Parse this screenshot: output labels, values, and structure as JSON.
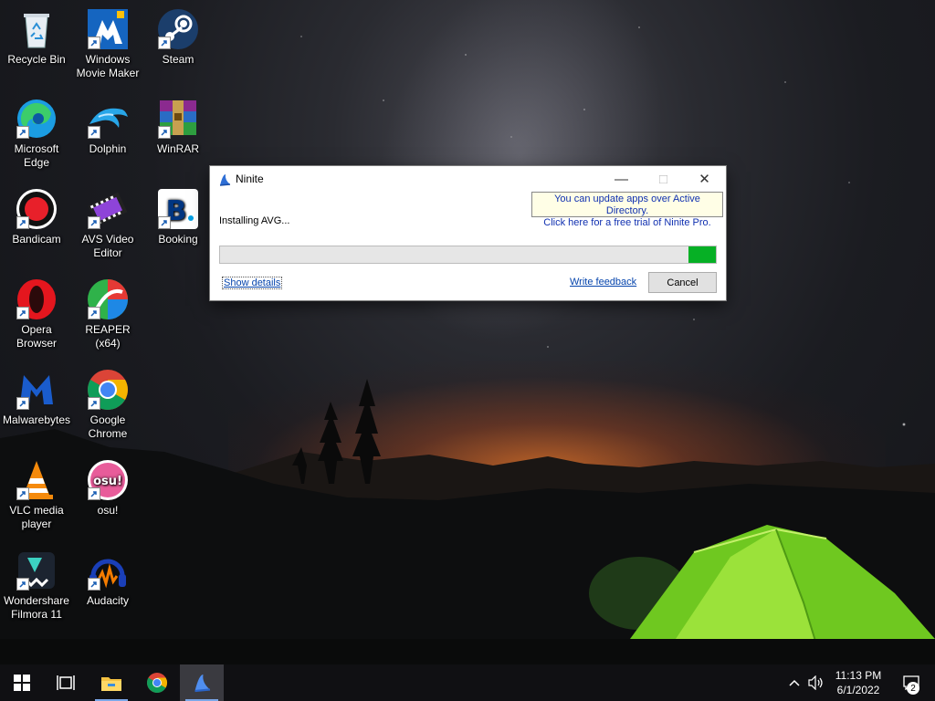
{
  "desktop": {
    "icons": [
      {
        "label": "Recycle Bin",
        "icon": "recycle-bin-icon"
      },
      {
        "label": "Windows Movie Maker",
        "icon": "movie-maker-icon"
      },
      {
        "label": "Steam",
        "icon": "steam-icon"
      },
      {
        "label": "Microsoft Edge",
        "icon": "edge-icon"
      },
      {
        "label": "Dolphin",
        "icon": "dolphin-icon"
      },
      {
        "label": "WinRAR",
        "icon": "winrar-icon"
      },
      {
        "label": "Bandicam",
        "icon": "bandicam-icon"
      },
      {
        "label": "AVS Video Editor",
        "icon": "avs-video-editor-icon"
      },
      {
        "label": "Booking",
        "icon": "booking-icon"
      },
      {
        "label": "Opera Browser",
        "icon": "opera-icon"
      },
      {
        "label": "REAPER (x64)",
        "icon": "reaper-icon"
      },
      {
        "label": "Malwarebytes",
        "icon": "malwarebytes-icon"
      },
      {
        "label": "Google Chrome",
        "icon": "chrome-icon"
      },
      {
        "label": "VLC media player",
        "icon": "vlc-icon"
      },
      {
        "label": "osu!",
        "icon": "osu-icon"
      },
      {
        "label": "Wondershare Filmora 11",
        "icon": "filmora-icon"
      },
      {
        "label": "Audacity",
        "icon": "audacity-icon"
      }
    ]
  },
  "ninite": {
    "title": "Ninite",
    "status": "Installing AVG...",
    "tooltip_line1": "You can update apps over Active Directory.",
    "tooltip_line2": "Click here for a free trial of Ninite Pro.",
    "progress_remaining_fraction": 0.055,
    "progress_color": "#06b025",
    "show_details": "Show details",
    "write_feedback": "Write feedback",
    "cancel": "Cancel"
  },
  "taskbar": {
    "pinned": [
      "start-icon",
      "task-view-icon",
      "file-explorer-icon",
      "chrome-icon",
      "ninite-icon"
    ],
    "time": "11:13 PM",
    "date": "6/1/2022",
    "notification_count": "2"
  }
}
